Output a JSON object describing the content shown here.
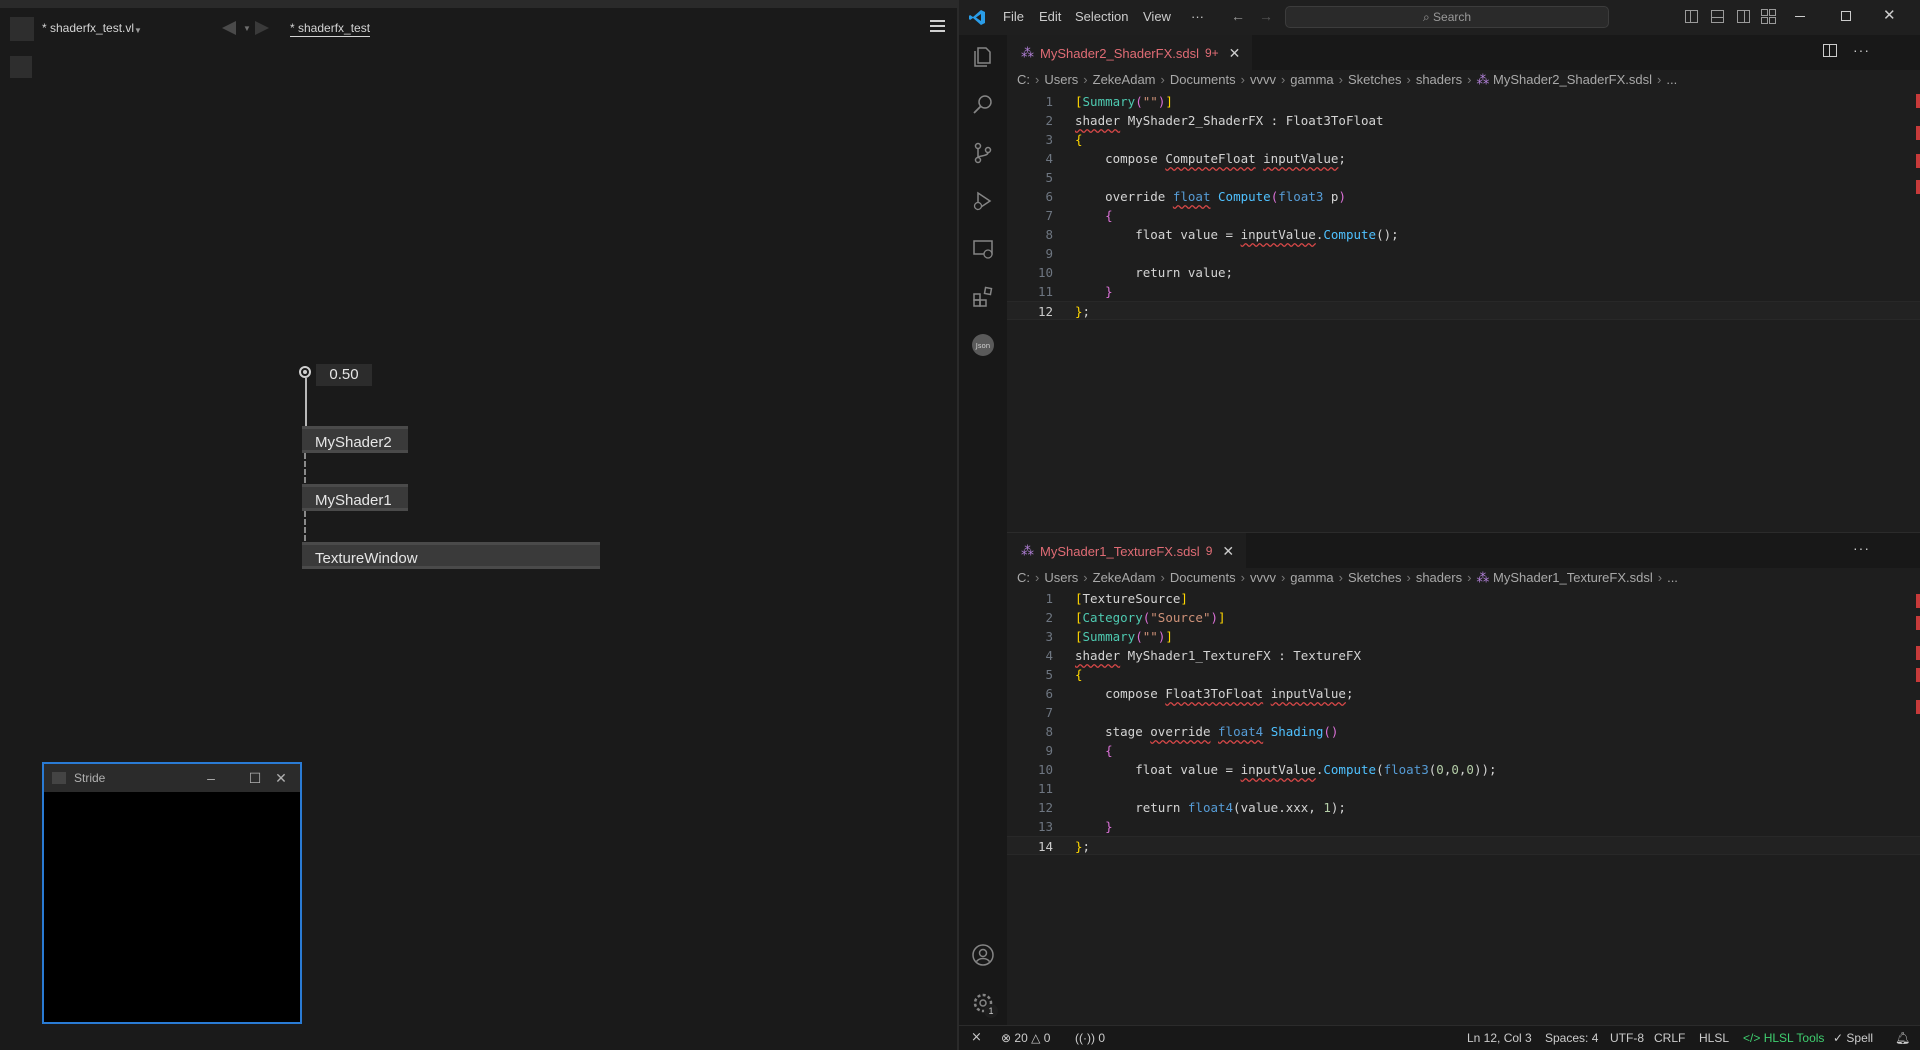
{
  "vvvv": {
    "doc_tab": "* shaderfx_test.vl",
    "patch_tab": "* shaderfx_test",
    "iobox_value": "0.50",
    "nodes": [
      "MyShader2",
      "MyShader1",
      "TextureWindow"
    ],
    "stride_window": {
      "title": "Stride",
      "minimize": "–",
      "maximize": "☐",
      "close": "✕"
    }
  },
  "vscode": {
    "menu": [
      "File",
      "Edit",
      "Selection",
      "View",
      "···"
    ],
    "search_placeholder": "Search",
    "editor1": {
      "tab": {
        "name": "MyShader2_ShaderFX.sdsl",
        "problems": "9+"
      },
      "breadcrumb": [
        "C:",
        "Users",
        "ZekeAdam",
        "Documents",
        "vvvv",
        "gamma",
        "Sketches",
        "shaders",
        "MyShader2_ShaderFX.sdsl",
        "..."
      ],
      "line_numbers": [
        "1",
        "2",
        "3",
        "4",
        "5",
        "6",
        "7",
        "8",
        "9",
        "10",
        "11",
        "12"
      ]
    },
    "editor2": {
      "tab": {
        "name": "MyShader1_TextureFX.sdsl",
        "problems": "9"
      },
      "breadcrumb": [
        "C:",
        "Users",
        "ZekeAdam",
        "Documents",
        "vvvv",
        "gamma",
        "Sketches",
        "shaders",
        "MyShader1_TextureFX.sdsl",
        "..."
      ],
      "line_numbers": [
        "1",
        "2",
        "3",
        "4",
        "5",
        "6",
        "7",
        "8",
        "9",
        "10",
        "11",
        "12",
        "13",
        "14"
      ]
    },
    "status": {
      "errors": "20",
      "warnings": "0",
      "ports": "0",
      "position": "Ln 12, Col 3",
      "spaces": "Spaces: 4",
      "encoding": "UTF-8",
      "eol": "CRLF",
      "language": "HLSL",
      "tools": "HLSL Tools",
      "spell": "Spell",
      "settings_badge": "1"
    },
    "colors": {
      "accent": "#2a7bd4",
      "error": "#c73a3a",
      "tab_error_text": "#e06c75"
    }
  }
}
